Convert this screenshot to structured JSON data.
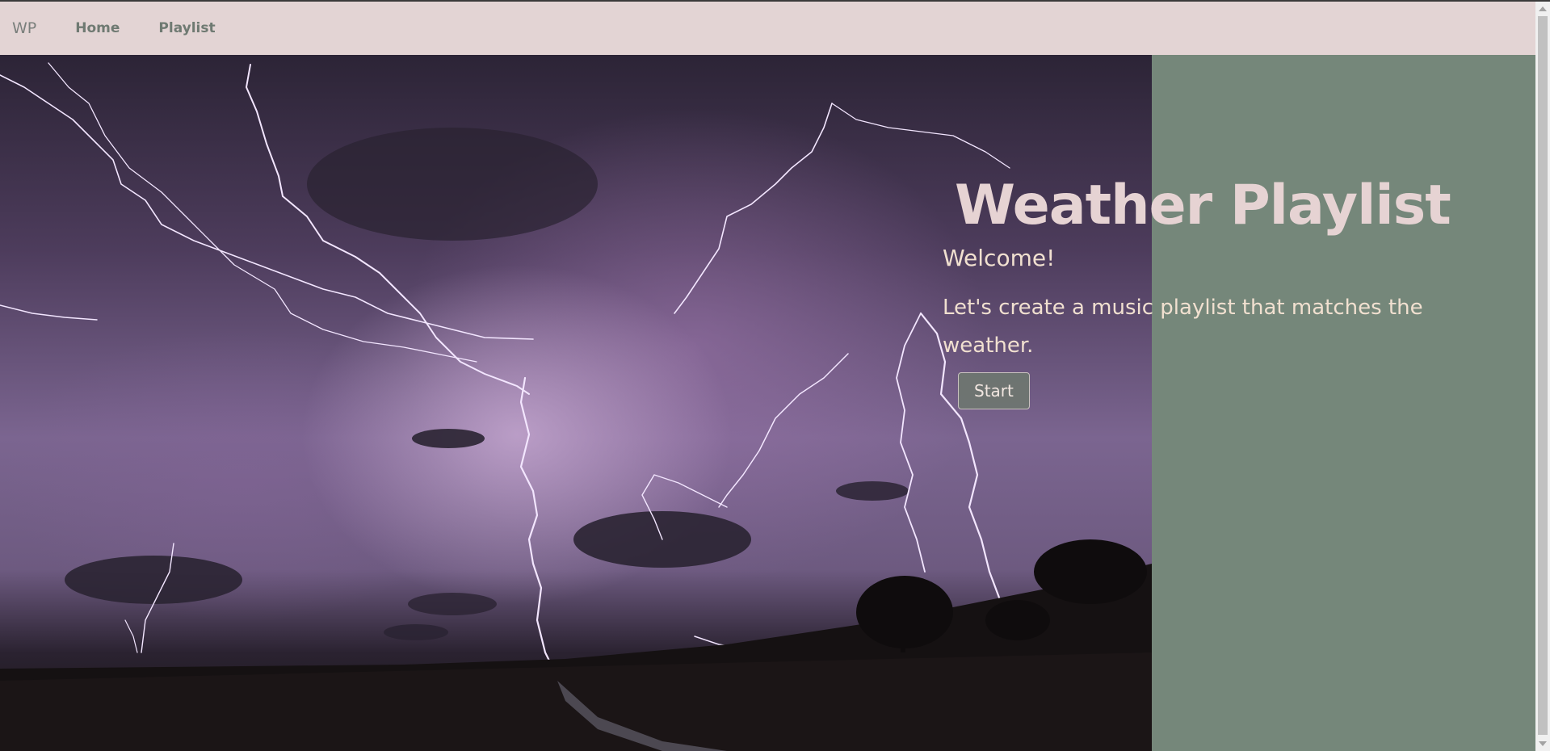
{
  "navbar": {
    "brand": "WP",
    "links": [
      {
        "label": "Home"
      },
      {
        "label": "Playlist"
      }
    ]
  },
  "hero": {
    "title": "Weather Playlist",
    "welcome": "Welcome!",
    "description": "Let's create a music playlist that matches the weather.",
    "start_label": "Start",
    "background_image": "thunderstorm-lightning-over-field"
  },
  "colors": {
    "navbar_bg": "#e3d4d4",
    "page_bg": "#75877a",
    "title": "#e6d3d3",
    "body_text": "#f1e0d0"
  }
}
